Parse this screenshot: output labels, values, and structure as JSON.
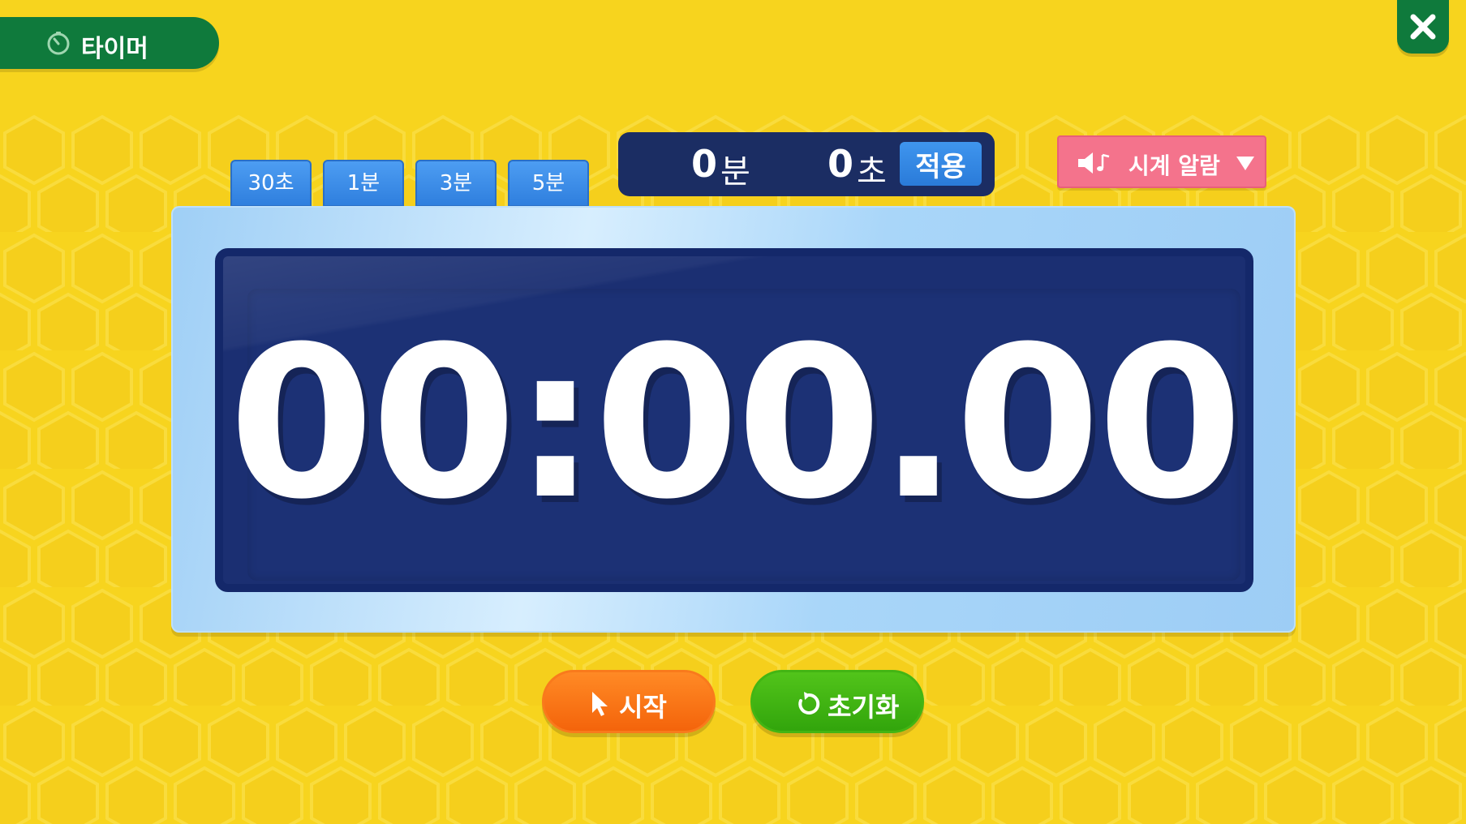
{
  "app": {
    "title": "타이머",
    "title_icon": "stopwatch-icon",
    "close_icon": "close-icon"
  },
  "presets": [
    {
      "label": "30초"
    },
    {
      "label": "1분"
    },
    {
      "label": "3분"
    },
    {
      "label": "5분"
    }
  ],
  "time_input": {
    "minutes": "0",
    "minutes_unit": "분",
    "seconds": "0",
    "seconds_unit": "초",
    "apply_label": "적용"
  },
  "sound": {
    "icon": "speaker-music-icon",
    "selected": "시계 알람",
    "caret_icon": "caret-down-icon"
  },
  "display": {
    "time": "00:00.00"
  },
  "actions": {
    "start_label": "시작",
    "start_icon": "cursor-icon",
    "reset_label": "초기화",
    "reset_icon": "refresh-icon"
  },
  "colors": {
    "background": "#f7d41e",
    "title_bar": "#0f7a3c",
    "display_screen": "#1b2f72",
    "preset_blue": "#3b8ee9",
    "sound_pink": "#f4738c",
    "start_orange": "#f77515",
    "reset_green": "#3fb314"
  }
}
